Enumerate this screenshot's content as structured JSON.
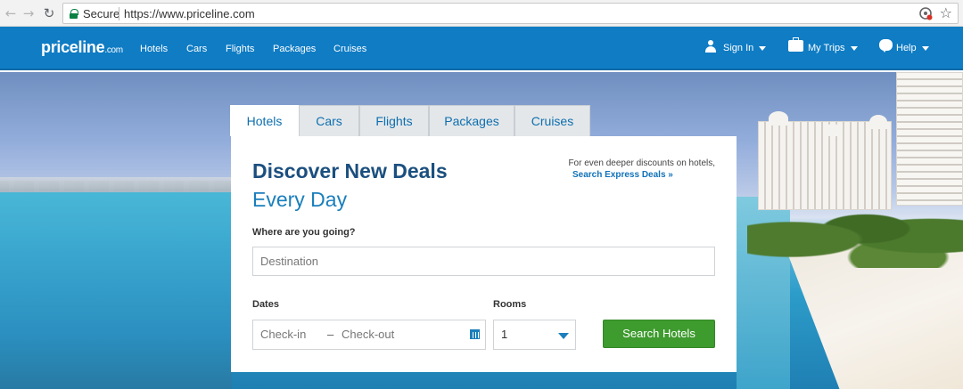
{
  "browser": {
    "secure_label": "Secure",
    "url": "https://www.priceline.com"
  },
  "header": {
    "logo_main": "priceline",
    "logo_suffix": ".com",
    "nav": [
      "Hotels",
      "Cars",
      "Flights",
      "Packages",
      "Cruises"
    ],
    "sign_in": "Sign In",
    "my_trips": "My Trips",
    "help": "Help"
  },
  "search": {
    "tabs": [
      "Hotels",
      "Cars",
      "Flights",
      "Packages",
      "Cruises"
    ],
    "active_tab": "Hotels",
    "title": "Discover New Deals",
    "subtitle": "Every Day",
    "promo_text": "For even deeper discounts on hotels,",
    "promo_link": "Search Express Deals »",
    "destination_label": "Where are you going?",
    "destination_placeholder": "Destination",
    "dates_label": "Dates",
    "checkin_placeholder": "Check-in",
    "date_separator": "–",
    "checkout_placeholder": "Check-out",
    "rooms_label": "Rooms",
    "rooms_value": "1",
    "search_button": "Search Hotels"
  },
  "colors": {
    "brand_blue": "#0f7cc4",
    "title_navy": "#1b4f7f",
    "accent_blue": "#1a7fbc",
    "button_green": "#3e9b2e"
  }
}
